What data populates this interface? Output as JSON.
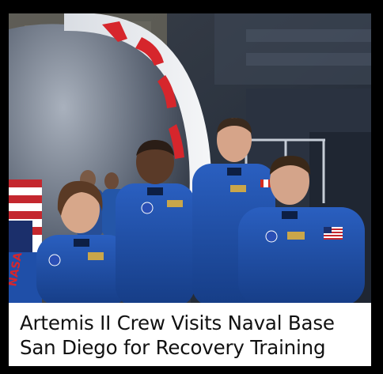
{
  "article": {
    "headline_line1": "Artemis II Crew Visits Naval Base",
    "headline_line2": "San Diego for Recovery Training"
  },
  "photo": {
    "capsule_mockup_lettering": "NASA",
    "flag_lettering": "NASA"
  },
  "colors": {
    "background": "#000000",
    "caption_background": "#ffffff",
    "caption_text": "#111111",
    "flight_suit": "#1f4fa8",
    "nasa_red": "#d6262c"
  }
}
